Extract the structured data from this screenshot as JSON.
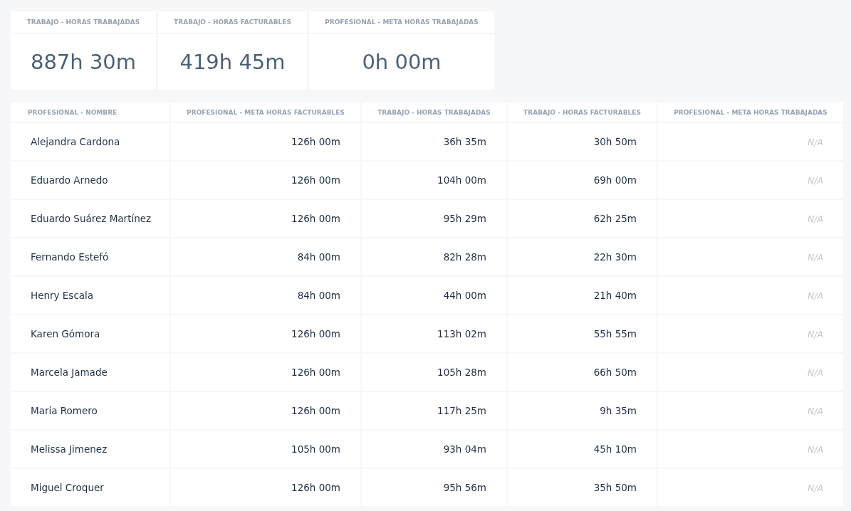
{
  "summary_cards": [
    {
      "label": "TRABAJO - HORAS TRABAJADAS",
      "value": "887h 30m"
    },
    {
      "label": "TRABAJO - HORAS FACTURABLES",
      "value": "419h 45m"
    },
    {
      "label": "PROFESIONAL - META HORAS TRABAJADAS",
      "value": "0h 00m"
    }
  ],
  "table": {
    "columns": [
      "PROFESIONAL - NOMBRE",
      "PROFESIONAL - META HORAS FACTURABLES",
      "TRABAJO - HORAS TRABAJADAS",
      "TRABAJO - HORAS FACTURABLES",
      "PROFESIONAL - META HORAS TRABAJADAS"
    ],
    "rows": [
      {
        "cells": [
          "Alejandra Cardona",
          "126h 00m",
          "36h 35m",
          "30h 50m",
          "N/A"
        ]
      },
      {
        "cells": [
          "Eduardo Arnedo",
          "126h 00m",
          "104h 00m",
          "69h 00m",
          "N/A"
        ]
      },
      {
        "cells": [
          "Eduardo Suárez Martínez",
          "126h 00m",
          "95h 29m",
          "62h 25m",
          "N/A"
        ]
      },
      {
        "cells": [
          "Fernando Estefó",
          "84h 00m",
          "82h 28m",
          "22h 30m",
          "N/A"
        ]
      },
      {
        "cells": [
          "Henry Escala",
          "84h 00m",
          "44h 00m",
          "21h 40m",
          "N/A"
        ]
      },
      {
        "cells": [
          "Karen Gómora",
          "126h 00m",
          "113h 02m",
          "55h 55m",
          "N/A"
        ]
      },
      {
        "cells": [
          "Marcela Jamade",
          "126h 00m",
          "105h 28m",
          "66h 50m",
          "N/A"
        ]
      },
      {
        "cells": [
          "María Romero",
          "126h 00m",
          "117h 25m",
          "9h 35m",
          "N/A"
        ]
      },
      {
        "cells": [
          "Melissa Jimenez",
          "105h 00m",
          "93h 04m",
          "45h 10m",
          "N/A"
        ]
      },
      {
        "cells": [
          "Miguel Croquer",
          "126h 00m",
          "95h 56m",
          "35h 50m",
          "N/A"
        ]
      }
    ]
  }
}
